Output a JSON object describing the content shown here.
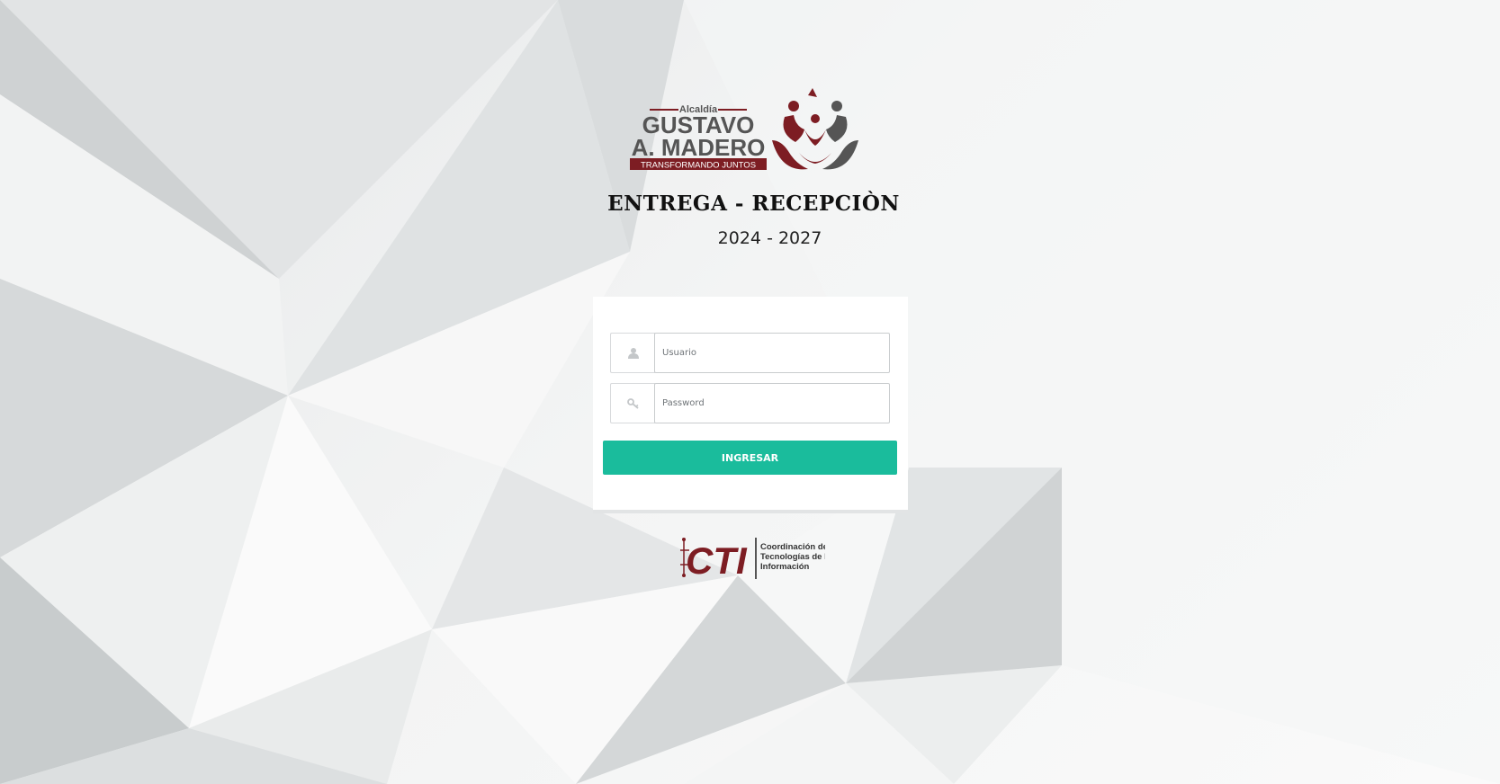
{
  "logos": {
    "alcaldia": {
      "prefix": "Alcaldía",
      "line1": "GUSTAVO",
      "line2": "A. MADERO",
      "tagline": "TRANSFORMANDO JUNTOS"
    },
    "cti": {
      "mark": "CTI",
      "line1": "Coordinación de",
      "line2": "Tecnologías de la",
      "line3": "Información"
    }
  },
  "header": {
    "title": "ENTREGA - RECEPCIÒN",
    "period": "2024 - 2027"
  },
  "login": {
    "username_placeholder": "Usuario",
    "password_placeholder": "Password",
    "submit_label": "INGRESAR",
    "user_icon": "user-icon",
    "password_icon": "key-icon"
  },
  "colors": {
    "brand_red": "#7d1d23",
    "brand_gray": "#4a4a4a",
    "button": "#1abc9c"
  }
}
